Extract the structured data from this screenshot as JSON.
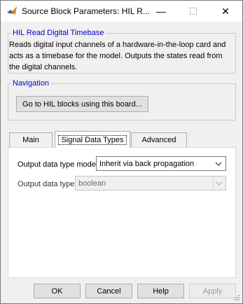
{
  "window": {
    "title": "Source Block Parameters: HIL R...",
    "icon": "matlab-icon",
    "controls": {
      "minimize": "—",
      "maximize": "☐",
      "close": "✕"
    }
  },
  "description_group": {
    "legend": "HIL Read Digital Timebase",
    "text": "Reads digital input channels of a hardware-in-the-loop card and acts as a timebase for the model. Outputs the states read from the digital channels."
  },
  "navigation_group": {
    "legend": "Navigation",
    "goto_button": "Go to HIL blocks using this board..."
  },
  "tabs": [
    {
      "label": "Main",
      "selected": false
    },
    {
      "label": "Signal Data Types",
      "selected": true
    },
    {
      "label": "Advanced",
      "selected": false
    }
  ],
  "signal_data_types": {
    "output_mode_label": "Output data type mode:",
    "output_mode_value": "Inherit via back propagation",
    "output_type_label": "Output data type:",
    "output_type_value": "boolean"
  },
  "buttons": {
    "ok": "OK",
    "cancel": "Cancel",
    "help": "Help",
    "apply": "Apply"
  }
}
